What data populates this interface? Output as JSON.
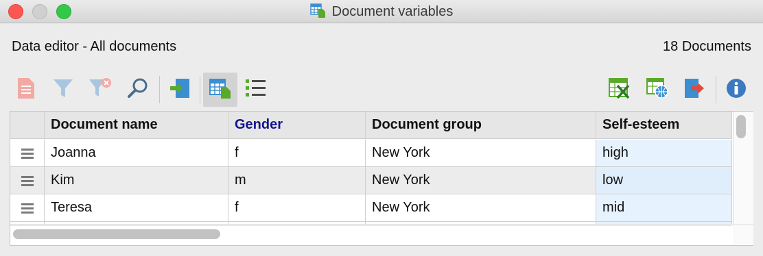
{
  "window": {
    "title": "Document variables"
  },
  "header": {
    "editor_title": "Data editor - All documents",
    "document_count": "18 Documents"
  },
  "toolbar": {
    "left": [
      {
        "name": "new-document-icon",
        "enabled": false
      },
      {
        "name": "filter-icon",
        "enabled": false
      },
      {
        "name": "clear-filter-icon",
        "enabled": false
      },
      {
        "name": "search-icon",
        "enabled": true
      },
      {
        "name": "import-icon",
        "enabled": true
      },
      {
        "name": "table-view-icon",
        "enabled": true,
        "active": true
      },
      {
        "name": "list-view-icon",
        "enabled": true
      }
    ],
    "right": [
      {
        "name": "export-excel-icon",
        "enabled": true
      },
      {
        "name": "export-web-icon",
        "enabled": true
      },
      {
        "name": "exit-icon",
        "enabled": true
      },
      {
        "name": "info-icon",
        "enabled": true
      }
    ]
  },
  "table": {
    "columns": [
      "Document name",
      "Gender",
      "Document group",
      "Self-esteem"
    ],
    "rows": [
      [
        "Joanna",
        "f",
        "New York",
        "high"
      ],
      [
        "Kim",
        "m",
        "New York",
        "low"
      ],
      [
        "Teresa",
        "f",
        "New York",
        "mid"
      ]
    ]
  },
  "colors": {
    "accent_blue": "#3b8fd0",
    "green": "#5aaa2a",
    "gender_header": "#14148c",
    "selected_column": "#e6f2fd"
  }
}
